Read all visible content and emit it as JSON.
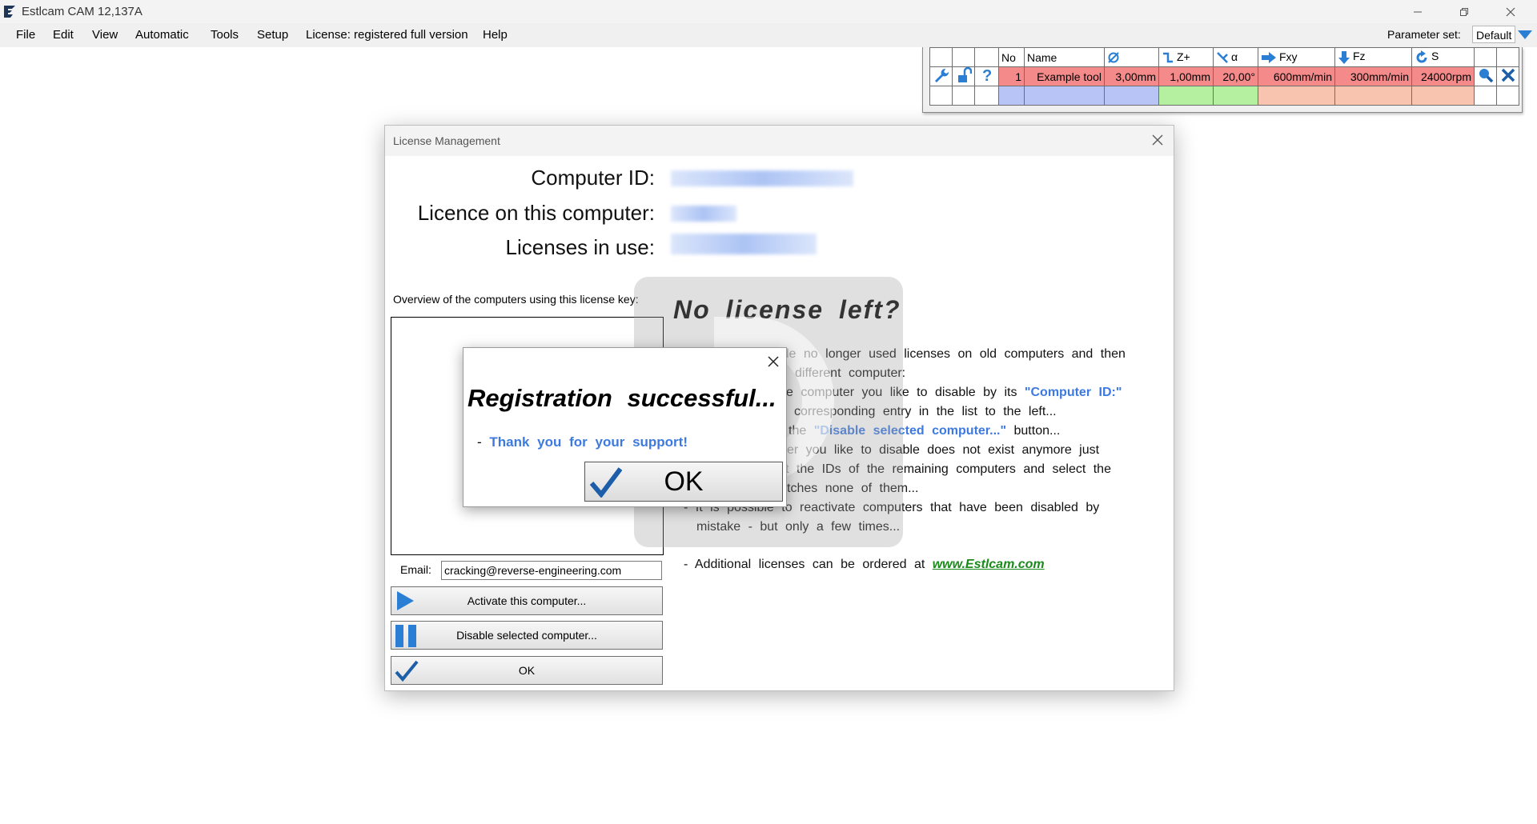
{
  "app": {
    "title": "Estlcam CAM 12,137A",
    "icon": "estlcam-logo-icon",
    "window_buttons": [
      "minimize-icon",
      "restore-icon",
      "close-icon"
    ]
  },
  "menu": {
    "items": [
      "File",
      "Edit",
      "View",
      "Automatic",
      "Tools",
      "Setup",
      "License: registered full version",
      "Help"
    ],
    "parameter_set_label": "Parameter set:",
    "parameter_set_value": "Default"
  },
  "tool_table": {
    "headers": {
      "no": "No",
      "name": "Name",
      "zplus": "Z+",
      "alpha": "α",
      "fxy": "Fxy",
      "fz": "Fz",
      "s": "S"
    },
    "row": {
      "no": "1",
      "name": "Example tool",
      "diameter": "3,00mm",
      "zplus": "1,00mm",
      "alpha": "20,00°",
      "fxy": "600mm/min",
      "fz": "300mm/min",
      "s": "24000rpm"
    },
    "colors": {
      "red": "#f58a8a",
      "blue": "#b8c4f5",
      "green": "#b5f0a0",
      "salmon": "#f8c4b0"
    }
  },
  "license_dialog": {
    "title": "License Management",
    "computer_id_label": "Computer ID:",
    "licence_label": "Licence on this computer:",
    "in_use_label": "Licenses in use:",
    "overview_label": "Overview of the computers using this license key:",
    "email_label": "Email:",
    "email_value": "cracking@reverse-engineering.com",
    "activate_button": "Activate this computer...",
    "disable_button": "Disable selected computer...",
    "ok_button": "OK",
    "no_license_title": "No license left?",
    "lines": {
      "l1": "le no longer used licenses on old computers and then",
      "l2": "different computer:",
      "l3a": "e computer you like to disable by its ",
      "l3b": "\"Computer ID:\"",
      "l4": "corresponding entry in the list to the left...",
      "l5a": "the ",
      "l5b": "\"Disable selected computer...\"",
      "l5c": " button...",
      "l6": "er you like to disable does not exist anymore just",
      "l7": "t the IDs of the remaining computers and select the",
      "l8": "tches none of them...",
      "l9": "- It is possible to reactivate computers that have been disabled by",
      "l10": "mistake - but only a few times...",
      "l11a": "- Additional licenses can be ordered at ",
      "l11b": "www.Estlcam.com"
    }
  },
  "registration_dialog": {
    "title": "Registration successful...",
    "message_prefix": "- ",
    "message": "Thank you for your support!",
    "ok_button": "OK"
  }
}
